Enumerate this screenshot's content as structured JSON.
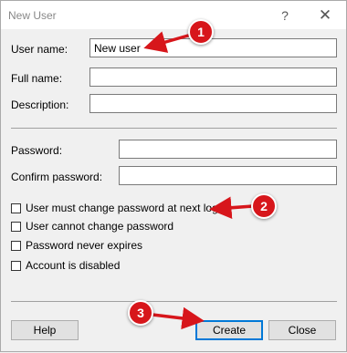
{
  "window": {
    "title": "New User",
    "help_glyph": "?",
    "close_glyph": "✕"
  },
  "form": {
    "user_name_label": "User name:",
    "user_name_value": "New user",
    "full_name_label": "Full name:",
    "full_name_value": "",
    "description_label": "Description:",
    "description_value": "",
    "password_label": "Password:",
    "password_value": "",
    "confirm_password_label": "Confirm password:",
    "confirm_password_value": ""
  },
  "options": [
    {
      "label": "User must change password at next logon",
      "checked": false
    },
    {
      "label": "User cannot change password",
      "checked": false
    },
    {
      "label": "Password never expires",
      "checked": false
    },
    {
      "label": "Account is disabled",
      "checked": false
    }
  ],
  "buttons": {
    "help": "Help",
    "create": "Create",
    "close": "Close"
  },
  "annotations": [
    {
      "number": "1"
    },
    {
      "number": "2"
    },
    {
      "number": "3"
    }
  ],
  "colors": {
    "annotation": "#d7161b",
    "default_button_border": "#0078d7"
  }
}
